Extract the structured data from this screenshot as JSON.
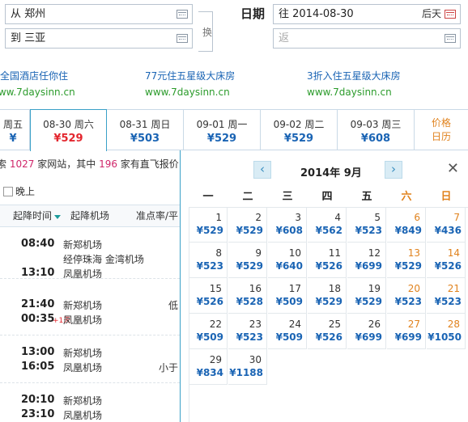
{
  "search": {
    "from_value": "从 郑州",
    "to_value": "到 三亚",
    "swap_label": "换",
    "date_label": "日期",
    "depart_value": "往 2014-08-30",
    "depart_suffix": "后天",
    "return_placeholder": "返"
  },
  "ads": [
    {
      "title": "玩全国酒店任你住",
      "url": "www.7daysinn.cn"
    },
    {
      "title": "77元住五星级大床房",
      "url": "www.7daysinn.cn"
    },
    {
      "title": "3折入住五星级大床房",
      "url": "www.7daysinn.cn"
    }
  ],
  "date_strip": {
    "items": [
      {
        "date": "周五",
        "price": "¥"
      },
      {
        "date": "08-30 周六",
        "price": "¥529"
      },
      {
        "date": "08-31 周日",
        "price": "¥503"
      },
      {
        "date": "09-01 周一",
        "price": "¥529"
      },
      {
        "date": "09-02 周二",
        "price": "¥529"
      },
      {
        "date": "09-03 周三",
        "price": "¥608"
      }
    ],
    "price_calendar": [
      "价格",
      "日历"
    ]
  },
  "results": {
    "meta_pre": "索",
    "sites": "1027",
    "meta_mid": "家网站，其中",
    "direct": "196",
    "meta_post": "家有直飞报价",
    "filter_label": "晚上",
    "columns": {
      "time": "起降时间",
      "airport": "起降机场",
      "ontime": "准点率/平"
    },
    "flights": [
      {
        "dep": "08:40",
        "arr": "13:10",
        "dep_airport": "新郑机场",
        "stop": "经停珠海 金湾机场",
        "arr_airport": "凤凰机场",
        "next_day": "",
        "extra": ""
      },
      {
        "dep": "21:40",
        "arr": "00:35",
        "dep_airport": "新郑机场",
        "stop": "",
        "arr_airport": "凤凰机场",
        "next_day": "+1天",
        "extra": "低"
      },
      {
        "dep": "13:00",
        "arr": "16:05",
        "dep_airport": "新郑机场",
        "stop": "",
        "arr_airport": "凤凰机场",
        "next_day": "",
        "extra": "小于"
      },
      {
        "dep": "20:10",
        "arr": "23:10",
        "dep_airport": "新郑机场",
        "stop": "",
        "arr_airport": "凤凰机场",
        "next_day": "",
        "extra": ""
      }
    ]
  },
  "calendar": {
    "title": "2014年 9月",
    "prev_icon": "chevron-left-icon",
    "next_icon": "chevron-right-icon",
    "weekdays": [
      "一",
      "二",
      "三",
      "四",
      "五",
      "六",
      "日"
    ],
    "days": [
      {
        "day": "1",
        "price": "¥529"
      },
      {
        "day": "2",
        "price": "¥529"
      },
      {
        "day": "3",
        "price": "¥608"
      },
      {
        "day": "4",
        "price": "¥562"
      },
      {
        "day": "5",
        "price": "¥523"
      },
      {
        "day": "6",
        "price": "¥849"
      },
      {
        "day": "7",
        "price": "¥436"
      },
      {
        "day": "8",
        "price": "¥523"
      },
      {
        "day": "9",
        "price": "¥529"
      },
      {
        "day": "10",
        "price": "¥640"
      },
      {
        "day": "11",
        "price": "¥526"
      },
      {
        "day": "12",
        "price": "¥699"
      },
      {
        "day": "13",
        "price": "¥529"
      },
      {
        "day": "14",
        "price": "¥526"
      },
      {
        "day": "15",
        "price": "¥526"
      },
      {
        "day": "16",
        "price": "¥528"
      },
      {
        "day": "17",
        "price": "¥509"
      },
      {
        "day": "18",
        "price": "¥529"
      },
      {
        "day": "19",
        "price": "¥529"
      },
      {
        "day": "20",
        "price": "¥523"
      },
      {
        "day": "21",
        "price": "¥523"
      },
      {
        "day": "22",
        "price": "¥509"
      },
      {
        "day": "23",
        "price": "¥523"
      },
      {
        "day": "24",
        "price": "¥509"
      },
      {
        "day": "25",
        "price": "¥526"
      },
      {
        "day": "26",
        "price": "¥699"
      },
      {
        "day": "27",
        "price": "¥699"
      },
      {
        "day": "28",
        "price": "¥1050"
      },
      {
        "day": "29",
        "price": "¥834"
      },
      {
        "day": "30",
        "price": "¥1188"
      }
    ]
  },
  "colors": {
    "accent": "#1a64b4",
    "active_price": "#e3262e",
    "weekend": "#e0821d",
    "ad_url": "#2b9b2b"
  }
}
